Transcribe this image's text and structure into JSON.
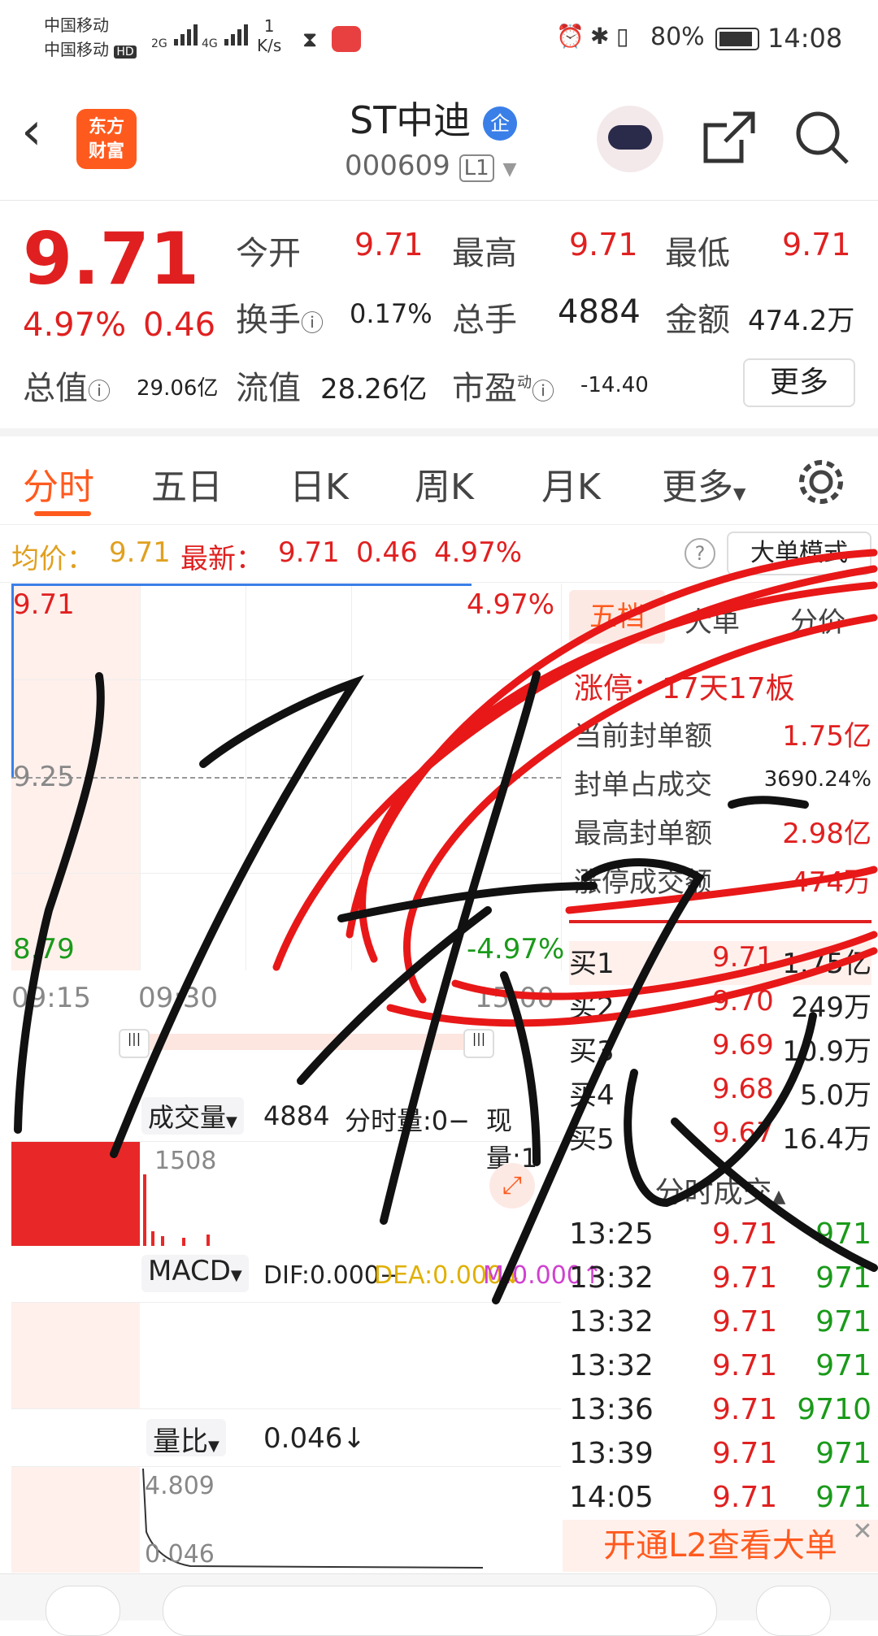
{
  "status": {
    "carrier1": "中国移动",
    "carrier2": "中国移动",
    "hd": "HD",
    "net1": "2G",
    "net2": "4G",
    "speed_value": "1",
    "speed_unit": "K/s",
    "battery": "80%",
    "time": "14:08"
  },
  "header": {
    "logo_line1": "东方",
    "logo_line2": "财富",
    "title": "ST中迪",
    "badge": "企",
    "code": "000609",
    "level": "L1"
  },
  "quote": {
    "price": "9.71",
    "change_pct": "4.97%",
    "change": "0.46",
    "open_label": "今开",
    "open": "9.71",
    "high_label": "最高",
    "high": "9.71",
    "low_label": "最低",
    "low": "9.71",
    "turnover_label": "换手",
    "turnover": "0.17%",
    "volume_label": "总手",
    "volume": "4884",
    "amount_label": "金额",
    "amount": "474.2万",
    "mktcap_label": "总值",
    "mktcap": "29.06亿",
    "float_label": "流值",
    "float_cap": "28.26亿",
    "pe_label": "市盈",
    "pe_sup": "动",
    "pe": "-14.40",
    "more": "更多"
  },
  "tabs": [
    "分时",
    "五日",
    "日K",
    "周K",
    "月K",
    "更多"
  ],
  "avg_line": {
    "avg_label": "均价：",
    "avg": "9.71",
    "latest_label": "最新：",
    "latest": "9.71",
    "chg": "0.46",
    "pct": "4.97%",
    "help": "?",
    "mode": "大单模式"
  },
  "chart": {
    "y_top": "9.71",
    "y_mid": "9.25",
    "y_bot": "8.79",
    "pct_top": "4.97%",
    "pct_bot": "-4.97%",
    "t_start": "09:15",
    "t_mid": "09:30",
    "t_end": "15:00",
    "volume_label": "成交量",
    "volume": "4884",
    "minute_vol": "分时量:0−",
    "current_vol": "现量:1",
    "vol_max": "1508",
    "macd_label": "MACD",
    "dif": "DIF:0.000−",
    "dea": "DEA:0.000↓",
    "m": "M:0.000↑",
    "lb_label": "量比",
    "lb": "0.046↓",
    "lb_top": "4.809",
    "lb_bot": "0.046"
  },
  "orderbook": {
    "tabs": [
      "五档",
      "大单",
      "分价"
    ],
    "limit_label": "涨停：",
    "limit": "17天17板",
    "stats": [
      {
        "label": "当前封单额",
        "value": "1.75亿"
      },
      {
        "label": "封单占成交",
        "value": "3690.24%"
      },
      {
        "label": "最高封单额",
        "value": "2.98亿"
      },
      {
        "label": "涨停成交额",
        "value": "474万"
      }
    ],
    "bids": [
      {
        "label": "买1",
        "price": "9.71",
        "vol": "1.75亿"
      },
      {
        "label": "买2",
        "price": "9.70",
        "vol": "249万"
      },
      {
        "label": "买3",
        "price": "9.69",
        "vol": "10.9万"
      },
      {
        "label": "买4",
        "price": "9.68",
        "vol": "5.0万"
      },
      {
        "label": "买5",
        "price": "9.67",
        "vol": "16.4万"
      }
    ],
    "ticks_title": "分时成交",
    "ticks": [
      {
        "time": "13:25",
        "price": "9.71",
        "vol": "971"
      },
      {
        "time": "13:32",
        "price": "9.71",
        "vol": "971"
      },
      {
        "time": "13:32",
        "price": "9.71",
        "vol": "971"
      },
      {
        "time": "13:32",
        "price": "9.71",
        "vol": "971"
      },
      {
        "time": "13:36",
        "price": "9.71",
        "vol": "9710"
      },
      {
        "time": "13:39",
        "price": "9.71",
        "vol": "971"
      },
      {
        "time": "14:05",
        "price": "9.71",
        "vol": "971"
      }
    ],
    "l2_banner": "开通L2查看大单"
  },
  "colors": {
    "up": "#e02020",
    "down": "#1a9a1a",
    "accent": "#ff5a1e"
  }
}
